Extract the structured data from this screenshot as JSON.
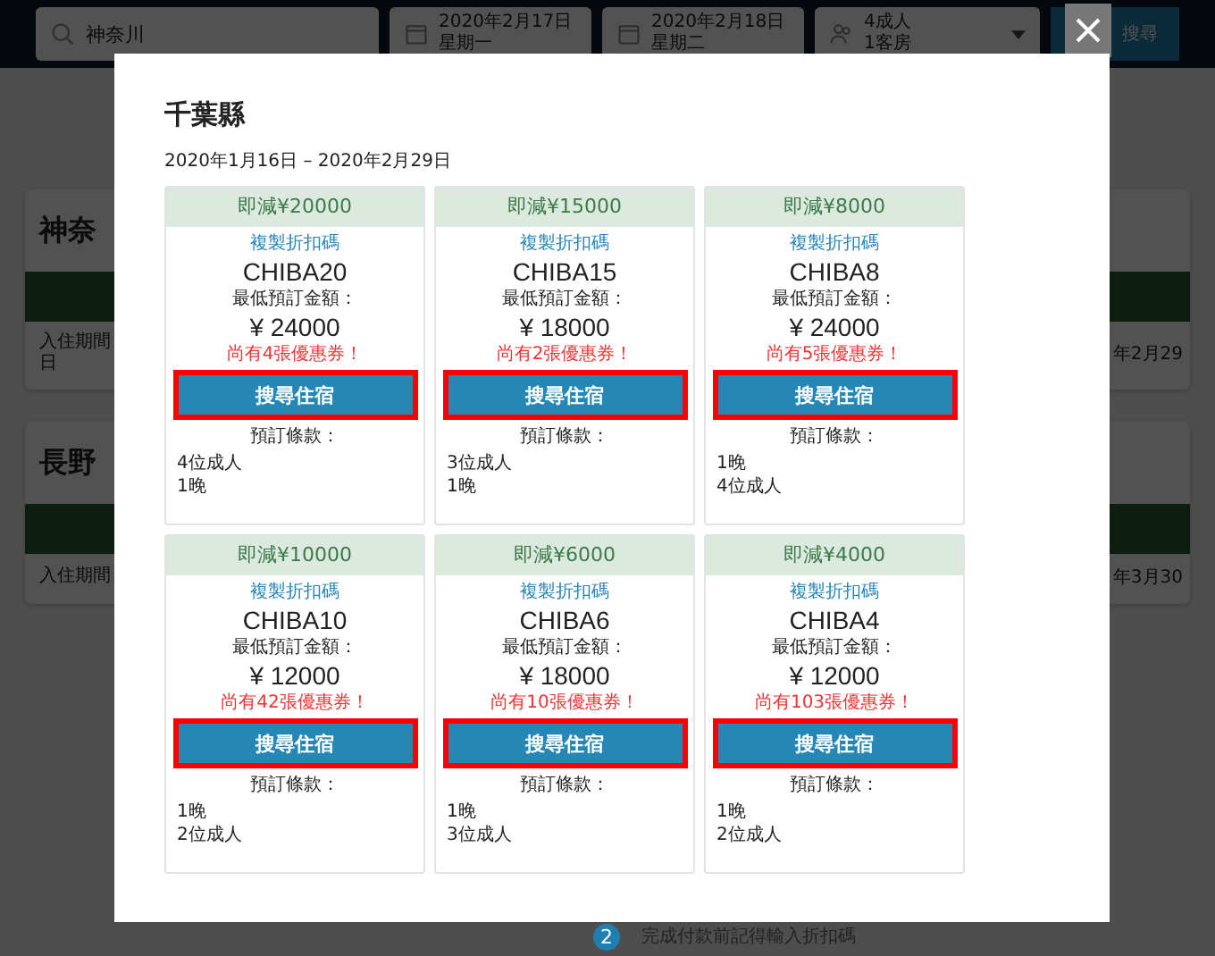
{
  "header": {
    "search": {
      "value": "神奈川"
    },
    "checkin": {
      "date": "2020年2月17日",
      "weekday": "星期一"
    },
    "checkout": {
      "date": "2020年2月18日",
      "weekday": "星期二"
    },
    "guests": {
      "adults": "4成人",
      "rooms": "1客房"
    },
    "search_button": "搜尋"
  },
  "background_cards": [
    {
      "title": "神奈",
      "period_start": "入住期間",
      "period_tail": "日",
      "period_end": "年2月29"
    },
    {
      "title": "長野",
      "period_start": "入住期間",
      "period_end": "年3月30"
    }
  ],
  "step": {
    "number": "2",
    "text": "完成付款前記得輸入折扣碼"
  },
  "modal": {
    "title": "千葉縣",
    "date_range": "2020年1月16日 – 2020年2月29日",
    "coupons": [
      {
        "discount": "即減¥20000",
        "copy_link": "複製折扣碼",
        "code": "CHIBA20",
        "min_label": "最低預訂金額：",
        "price": "¥ 24000",
        "remaining": "尚有4張優惠券！",
        "button": "搜尋住宿",
        "terms_label": "預訂條款：",
        "terms": [
          "4位成人",
          "1晚"
        ]
      },
      {
        "discount": "即減¥15000",
        "copy_link": "複製折扣碼",
        "code": "CHIBA15",
        "min_label": "最低預訂金額：",
        "price": "¥ 18000",
        "remaining": "尚有2張優惠券！",
        "button": "搜尋住宿",
        "terms_label": "預訂條款：",
        "terms": [
          "3位成人",
          "1晚"
        ]
      },
      {
        "discount": "即減¥8000",
        "copy_link": "複製折扣碼",
        "code": "CHIBA8",
        "min_label": "最低預訂金額：",
        "price": "¥ 24000",
        "remaining": "尚有5張優惠券！",
        "button": "搜尋住宿",
        "terms_label": "預訂條款：",
        "terms": [
          "1晚",
          "4位成人"
        ]
      },
      {
        "discount": "即減¥10000",
        "copy_link": "複製折扣碼",
        "code": "CHIBA10",
        "min_label": "最低預訂金額：",
        "price": "¥ 12000",
        "remaining": "尚有42張優惠券！",
        "button": "搜尋住宿",
        "terms_label": "預訂條款：",
        "terms": [
          "1晚",
          "2位成人"
        ]
      },
      {
        "discount": "即減¥6000",
        "copy_link": "複製折扣碼",
        "code": "CHIBA6",
        "min_label": "最低預訂金額：",
        "price": "¥ 18000",
        "remaining": "尚有10張優惠券！",
        "button": "搜尋住宿",
        "terms_label": "預訂條款：",
        "terms": [
          "1晚",
          "3位成人"
        ]
      },
      {
        "discount": "即減¥4000",
        "copy_link": "複製折扣碼",
        "code": "CHIBA4",
        "min_label": "最低預訂金額：",
        "price": "¥ 12000",
        "remaining": "尚有103張優惠券！",
        "button": "搜尋住宿",
        "terms_label": "預訂條款：",
        "terms": [
          "1晚",
          "2位成人"
        ]
      }
    ]
  }
}
